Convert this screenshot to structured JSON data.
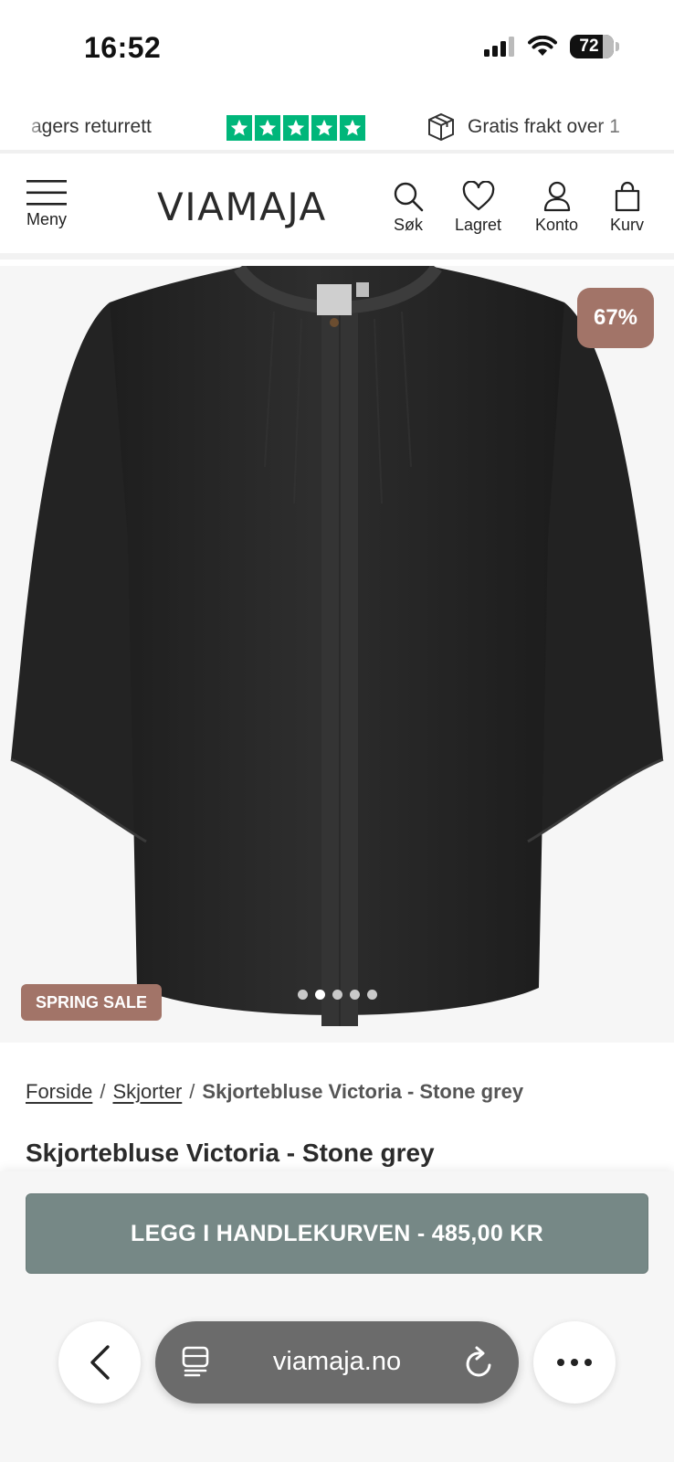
{
  "status_bar": {
    "time": "16:52",
    "battery": "72",
    "icons": [
      "signal-icon",
      "wifi-icon",
      "battery-icon"
    ]
  },
  "trust_banner": {
    "return_text": "agers returrett",
    "rating_stars": 5,
    "shipping_text": "Gratis frakt over 1",
    "star_color": "#00b67a"
  },
  "header": {
    "logo": "VIAMAJA",
    "menu_label": "Meny",
    "search_label": "Søk",
    "saved_label": "Lagret",
    "account_label": "Konto",
    "cart_label": "Kurv"
  },
  "product": {
    "discount_badge": "67%",
    "sale_badge": "SPRING SALE",
    "image_count": 5,
    "active_image": 2,
    "title": "Skjortebluse Victoria - Stone grey",
    "badge_color": "#a27468"
  },
  "breadcrumb": {
    "home": "Forside",
    "separator": "/",
    "category": "Skjorter",
    "current": "Skjortebluse Victoria - Stone grey"
  },
  "cart_button": {
    "label": "LEGG I HANDLEKURVEN - 485,00 KR",
    "color": "#768886"
  },
  "browser": {
    "url": "viamaja.no"
  }
}
